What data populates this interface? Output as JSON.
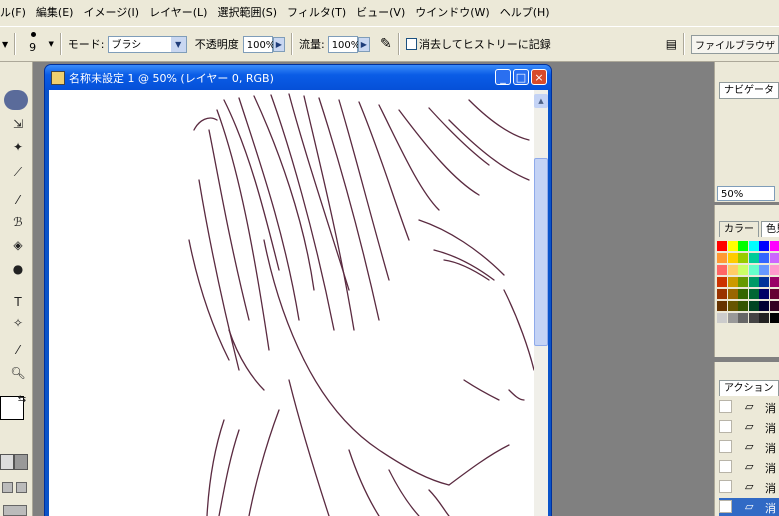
{
  "menubar": {
    "items": [
      "ル(F)",
      "編集(E)",
      "イメージ(I)",
      "レイヤー(L)",
      "選択範囲(S)",
      "フィルタ(T)",
      "ビュー(V)",
      "ウインドウ(W)",
      "ヘルプ(H)"
    ]
  },
  "options": {
    "brush_size": "9",
    "mode_label": "モード:",
    "mode_value": "ブラシ",
    "opacity_label": "不透明度",
    "opacity_value": "100%",
    "flow_label": "流量:",
    "flow_value": "100%",
    "erase_history_label": "消去してヒストリーに記録",
    "file_browser_tab": "ファイルブラウザ"
  },
  "document": {
    "title": "名称未設定 1 @ 50% (レイヤー 0, RGB)",
    "minimize": "_",
    "maximize": "□",
    "close": "×"
  },
  "navigator": {
    "tab": "ナビゲータ",
    "zoom": "50%"
  },
  "color": {
    "tab1": "カラー",
    "tab2": "色見"
  },
  "actions": {
    "tab": "アクション",
    "rows": [
      "消",
      "消",
      "消",
      "消",
      "消",
      "消"
    ]
  },
  "colors": {
    "swatches": [
      [
        "#ff0000",
        "#ffff00",
        "#00ff00",
        "#00ffff",
        "#0000ff",
        "#ff00ff"
      ],
      [
        "#ff9933",
        "#ffcc00",
        "#99cc00",
        "#00cc99",
        "#3366ff",
        "#cc66ff"
      ],
      [
        "#ff6666",
        "#ffcc66",
        "#ccff66",
        "#66ffcc",
        "#6699ff",
        "#ff99cc"
      ],
      [
        "#cc3300",
        "#cc9900",
        "#669900",
        "#009966",
        "#003399",
        "#990066"
      ],
      [
        "#993300",
        "#996600",
        "#336600",
        "#006633",
        "#000066",
        "#660033"
      ],
      [
        "#663300",
        "#665500",
        "#335500",
        "#004422",
        "#000033",
        "#330022"
      ],
      [
        "#cccccc",
        "#999999",
        "#666666",
        "#444444",
        "#222222",
        "#000000"
      ]
    ]
  }
}
